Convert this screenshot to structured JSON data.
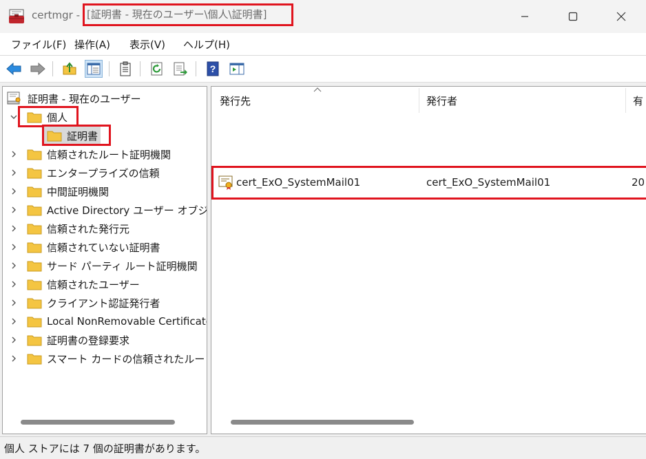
{
  "window": {
    "app_name": "certmgr -",
    "path": "[証明書 - 現在のユーザー\\個人\\証明書]"
  },
  "menu": [
    "ファイル(F)",
    "操作(A)",
    "表示(V)",
    "ヘルプ(H)"
  ],
  "tree": {
    "root": "証明書 - 現在のユーザー",
    "personal": "個人",
    "personal_child": "証明書",
    "stores": [
      "信頼されたルート証明機関",
      "エンタープライズの信頼",
      "中間証明機関",
      "Active Directory ユーザー オブジェクト",
      "信頼された発行元",
      "信頼されていない証明書",
      "サード パーティ ルート証明機関",
      "信頼されたユーザー",
      "クライアント認証発行者",
      "Local NonRemovable Certificates",
      "証明書の登録要求",
      "スマート カードの信頼されたルート"
    ]
  },
  "list": {
    "columns": [
      "発行先",
      "発行者",
      "有"
    ],
    "rows": [
      {
        "issued_to": "cert_ExO_SystemMail01",
        "issued_by": "cert_ExO_SystemMail01",
        "expires": "20"
      }
    ]
  },
  "status": "個人 ストアには 7 個の証明書があります。",
  "colors": {
    "highlight": "#e0141e",
    "folder": "#f4c542",
    "selection": "#cfe4f7"
  }
}
